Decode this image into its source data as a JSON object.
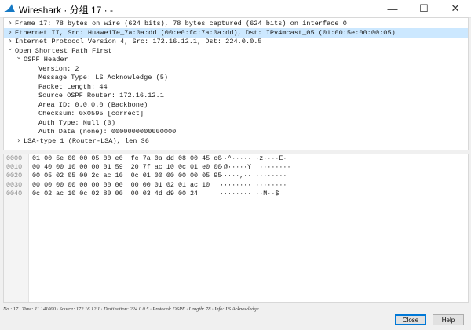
{
  "window": {
    "title": "Wireshark · 分组 17 · -",
    "minimize_glyph": "—",
    "maximize_glyph": "☐",
    "close_glyph": "✕"
  },
  "tree": [
    {
      "text": "Frame 17: 78 bytes on wire (624 bits), 78 bytes captured (624 bits) on interface 0",
      "level": 0,
      "state": "collapsed",
      "selected": false
    },
    {
      "text": "Ethernet II, Src: HuaweiTe_7a:0a:dd (00:e0:fc:7a:0a:dd), Dst: IPv4mcast_05 (01:00:5e:00:00:05)",
      "level": 0,
      "state": "collapsed",
      "selected": true
    },
    {
      "text": "Internet Protocol Version 4, Src: 172.16.12.1, Dst: 224.0.0.5",
      "level": 0,
      "state": "collapsed",
      "selected": false
    },
    {
      "text": "Open Shortest Path First",
      "level": 0,
      "state": "expanded",
      "selected": false
    },
    {
      "text": "OSPF Header",
      "level": 1,
      "state": "expanded",
      "selected": false
    },
    {
      "text": "Version: 2",
      "level": 2,
      "state": "leaf",
      "selected": false
    },
    {
      "text": "Message Type: LS Acknowledge (5)",
      "level": 2,
      "state": "leaf",
      "selected": false
    },
    {
      "text": "Packet Length: 44",
      "level": 2,
      "state": "leaf",
      "selected": false
    },
    {
      "text": "Source OSPF Router: 172.16.12.1",
      "level": 2,
      "state": "leaf",
      "selected": false
    },
    {
      "text": "Area ID: 0.0.0.0 (Backbone)",
      "level": 2,
      "state": "leaf",
      "selected": false
    },
    {
      "text": "Checksum: 0x0595 [correct]",
      "level": 2,
      "state": "leaf",
      "selected": false
    },
    {
      "text": "Auth Type: Null (0)",
      "level": 2,
      "state": "leaf",
      "selected": false
    },
    {
      "text": "Auth Data (none): 0000000000000000",
      "level": 2,
      "state": "leaf",
      "selected": false
    },
    {
      "text": "LSA-type 1 (Router-LSA), len 36",
      "level": 1,
      "state": "collapsed",
      "selected": false
    }
  ],
  "hex": [
    {
      "offset": "0000",
      "bytes": "01 00 5e 00 00 05 00 e0  fc 7a 0a dd 08 00 45 c0",
      "ascii": "··^····· ·z····E·"
    },
    {
      "offset": "0010",
      "bytes": "00 40 00 10 00 00 01 59  20 7f ac 10 0c 01 e0 00",
      "ascii": "·@·····Y  ········"
    },
    {
      "offset": "0020",
      "bytes": "00 05 02 05 00 2c ac 10  0c 01 00 00 00 00 05 95",
      "ascii": "·····,·· ········"
    },
    {
      "offset": "0030",
      "bytes": "00 00 00 00 00 00 00 00  00 00 01 02 01 ac 10",
      "ascii": "········ ········"
    },
    {
      "offset": "0040",
      "bytes": "0c 02 ac 10 0c 02 80 00  00 03 4d d9 00 24",
      "ascii": "········ ··M··$"
    }
  ],
  "status": "No.: 17 · Time: 11.141000 · Source: 172.16.12.1 · Destination: 224.0.0.5 · Protocol: OSPF · Length: 78 · Info: LS Acknowledge",
  "buttons": {
    "close": "Close",
    "help": "Help"
  },
  "icons": {
    "app": "wireshark-fin-icon",
    "expand": "chevron-right-icon",
    "collapse": "chevron-down-icon"
  }
}
